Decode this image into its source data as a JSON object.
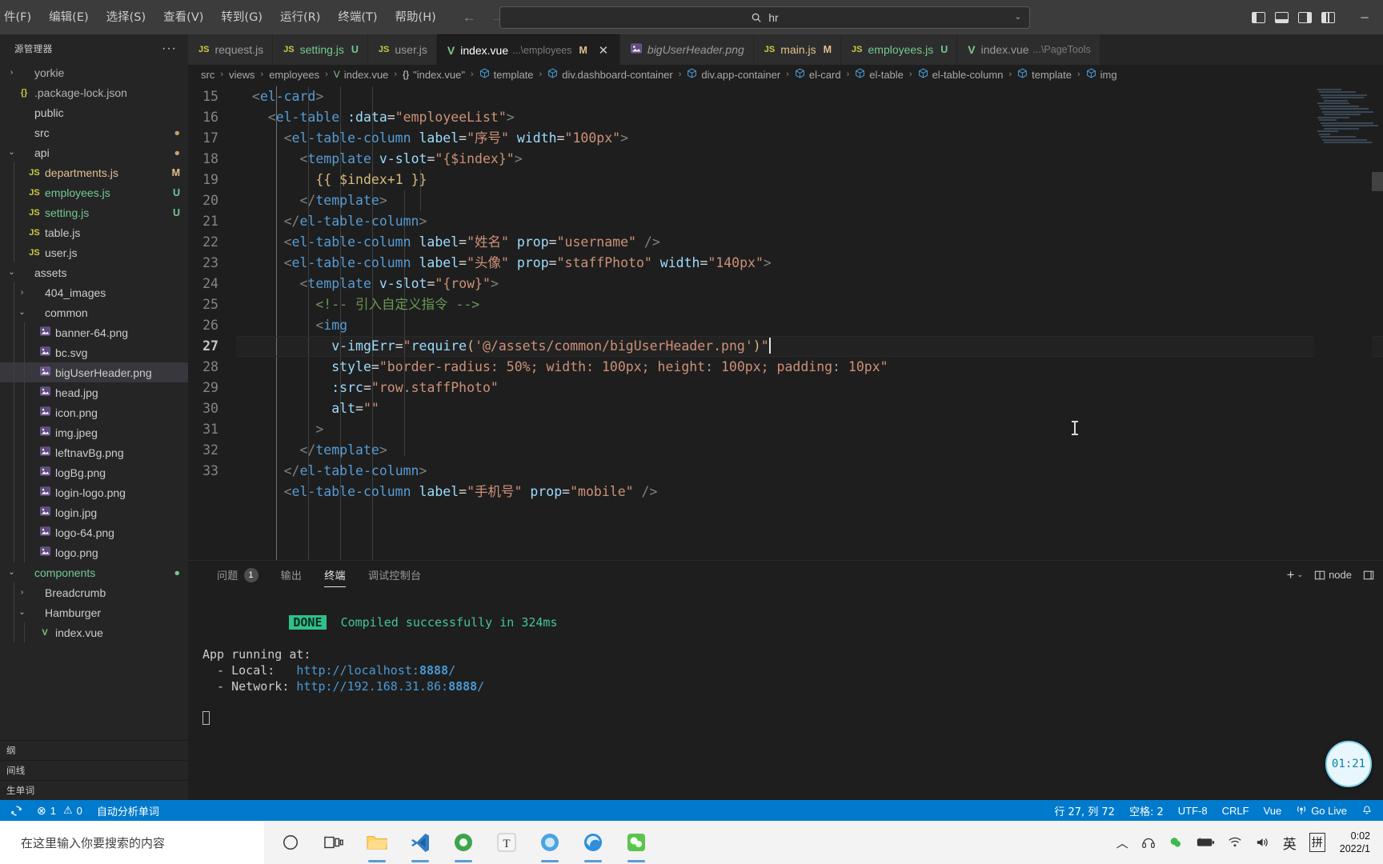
{
  "titlebar": {
    "menus": [
      "件(F)",
      "编辑(E)",
      "选择(S)",
      "查看(V)",
      "转到(G)",
      "运行(R)",
      "终端(T)",
      "帮助(H)"
    ],
    "back_icon": "←",
    "forward_icon": "→",
    "search": {
      "icon": "search-icon",
      "value": "hr",
      "chevron": "⌄"
    },
    "window_controls": {
      "minimize": "─",
      "maximize": "▢",
      "close": "✕"
    }
  },
  "sidebar": {
    "header": {
      "title": "源管理器",
      "more": "···"
    },
    "tree": [
      {
        "chev": "›",
        "icon": "",
        "icon_type": "none",
        "name": "yorkie",
        "badge": "",
        "badge_color": "",
        "indent": 0,
        "dim": true
      },
      {
        "chev": "",
        "icon": "{}",
        "icon_type": "json",
        "name": ".package-lock.json",
        "badge": "",
        "badge_color": "",
        "indent": 0,
        "dim": true
      },
      {
        "chev": "",
        "icon": "",
        "icon_type": "none",
        "name": "public",
        "badge": "",
        "badge_color": "",
        "indent": 0
      },
      {
        "chev": "",
        "icon": "",
        "icon_type": "none",
        "name": "src",
        "badge": "●",
        "badge_color": "#c5a06a",
        "indent": 0
      },
      {
        "chev": "⌄",
        "icon": "",
        "icon_type": "none",
        "name": "api",
        "badge": "●",
        "badge_color": "#c5a06a",
        "indent": 0
      },
      {
        "chev": "",
        "icon": "JS",
        "icon_type": "js",
        "name": "departments.js",
        "badge": "M",
        "badge_color": "#e2c08d",
        "indent": 1,
        "name_color": "#e2c08d"
      },
      {
        "chev": "",
        "icon": "JS",
        "icon_type": "js",
        "name": "employees.js",
        "badge": "U",
        "badge_color": "#73c991",
        "indent": 1,
        "name_color": "#73c991"
      },
      {
        "chev": "",
        "icon": "JS",
        "icon_type": "js",
        "name": "setting.js",
        "badge": "U",
        "badge_color": "#73c991",
        "indent": 1,
        "name_color": "#73c991"
      },
      {
        "chev": "",
        "icon": "JS",
        "icon_type": "js",
        "name": "table.js",
        "badge": "",
        "badge_color": "",
        "indent": 1
      },
      {
        "chev": "",
        "icon": "JS",
        "icon_type": "js",
        "name": "user.js",
        "badge": "",
        "badge_color": "",
        "indent": 1
      },
      {
        "chev": "⌄",
        "icon": "",
        "icon_type": "none",
        "name": "assets",
        "badge": "",
        "badge_color": "",
        "indent": 0
      },
      {
        "chev": "›",
        "icon": "",
        "icon_type": "none",
        "name": "404_images",
        "badge": "",
        "badge_color": "",
        "indent": 1
      },
      {
        "chev": "⌄",
        "icon": "",
        "icon_type": "none",
        "name": "common",
        "badge": "",
        "badge_color": "",
        "indent": 1
      },
      {
        "chev": "",
        "icon": "▣",
        "icon_type": "png",
        "name": "banner-64.png",
        "badge": "",
        "badge_color": "",
        "indent": 2
      },
      {
        "chev": "",
        "icon": "◧",
        "icon_type": "svg",
        "name": "bc.svg",
        "badge": "",
        "badge_color": "",
        "indent": 2
      },
      {
        "chev": "",
        "icon": "▣",
        "icon_type": "png",
        "name": "bigUserHeader.png",
        "badge": "",
        "badge_color": "",
        "indent": 2,
        "selected": true
      },
      {
        "chev": "",
        "icon": "▣",
        "icon_type": "png",
        "name": "head.jpg",
        "badge": "",
        "badge_color": "",
        "indent": 2
      },
      {
        "chev": "",
        "icon": "▣",
        "icon_type": "png",
        "name": "icon.png",
        "badge": "",
        "badge_color": "",
        "indent": 2
      },
      {
        "chev": "",
        "icon": "▣",
        "icon_type": "png",
        "name": "img.jpeg",
        "badge": "",
        "badge_color": "",
        "indent": 2
      },
      {
        "chev": "",
        "icon": "▣",
        "icon_type": "png",
        "name": "leftnavBg.png",
        "badge": "",
        "badge_color": "",
        "indent": 2
      },
      {
        "chev": "",
        "icon": "▣",
        "icon_type": "png",
        "name": "logBg.png",
        "badge": "",
        "badge_color": "",
        "indent": 2
      },
      {
        "chev": "",
        "icon": "▣",
        "icon_type": "png",
        "name": "login-logo.png",
        "badge": "",
        "badge_color": "",
        "indent": 2
      },
      {
        "chev": "",
        "icon": "▣",
        "icon_type": "png",
        "name": "login.jpg",
        "badge": "",
        "badge_color": "",
        "indent": 2
      },
      {
        "chev": "",
        "icon": "▣",
        "icon_type": "png",
        "name": "logo-64.png",
        "badge": "",
        "badge_color": "",
        "indent": 2
      },
      {
        "chev": "",
        "icon": "▣",
        "icon_type": "png",
        "name": "logo.png",
        "badge": "",
        "badge_color": "",
        "indent": 2
      },
      {
        "chev": "⌄",
        "icon": "",
        "icon_type": "none",
        "name": "components",
        "badge": "●",
        "badge_color": "#73c991",
        "indent": 0,
        "name_color": "#73c991"
      },
      {
        "chev": "›",
        "icon": "",
        "icon_type": "none",
        "name": "Breadcrumb",
        "badge": "",
        "badge_color": "",
        "indent": 1
      },
      {
        "chev": "⌄",
        "icon": "",
        "icon_type": "none",
        "name": "Hamburger",
        "badge": "",
        "badge_color": "",
        "indent": 1
      },
      {
        "chev": "",
        "icon": "V",
        "icon_type": "vue",
        "name": "index.vue",
        "badge": "",
        "badge_color": "",
        "indent": 2
      }
    ],
    "sections": [
      {
        "label": "纲",
        "chev": "›"
      },
      {
        "label": "间线",
        "chev": "›"
      },
      {
        "label": "生单词",
        "chev": "›"
      }
    ]
  },
  "tabs": [
    {
      "icon": "JS",
      "icon_type": "js",
      "name": "request.js",
      "desc": "",
      "status": "",
      "status_color": "",
      "active": false,
      "italic": false
    },
    {
      "icon": "JS",
      "icon_type": "js",
      "name": "setting.js",
      "desc": "",
      "status": "U",
      "status_color": "#73c991",
      "name_color": "#73c991",
      "active": false,
      "italic": false
    },
    {
      "icon": "JS",
      "icon_type": "js",
      "name": "user.js",
      "desc": "",
      "status": "",
      "status_color": "",
      "active": false,
      "italic": false
    },
    {
      "icon": "V",
      "icon_type": "vue",
      "name": "index.vue",
      "desc": "...\\employees",
      "status": "M",
      "status_color": "#e2c08d",
      "name_color": "#ffffff",
      "active": true,
      "italic": false,
      "close": "✕"
    },
    {
      "icon": "▣",
      "icon_type": "png",
      "name": "bigUserHeader.png",
      "desc": "",
      "status": "",
      "status_color": "",
      "active": false,
      "italic": true
    },
    {
      "icon": "JS",
      "icon_type": "js",
      "name": "main.js",
      "desc": "",
      "status": "M",
      "status_color": "#e2c08d",
      "name_color": "#e2c08d",
      "active": false,
      "italic": false
    },
    {
      "icon": "JS",
      "icon_type": "js",
      "name": "employees.js",
      "desc": "",
      "status": "U",
      "status_color": "#73c991",
      "name_color": "#73c991",
      "active": false,
      "italic": false
    },
    {
      "icon": "V",
      "icon_type": "vue",
      "name": "index.vue",
      "desc": "...\\PageTools",
      "status": "",
      "status_color": "",
      "active": false,
      "italic": false
    }
  ],
  "breadcrumb": [
    {
      "label": "src",
      "icon": ""
    },
    {
      "label": "views",
      "icon": ""
    },
    {
      "label": "employees",
      "icon": ""
    },
    {
      "label": "index.vue",
      "icon": "vue"
    },
    {
      "label": "\"index.vue\"",
      "icon": "json"
    },
    {
      "label": "template",
      "icon": "cube"
    },
    {
      "label": "div.dashboard-container",
      "icon": "cube"
    },
    {
      "label": "div.app-container",
      "icon": "cube"
    },
    {
      "label": "el-card",
      "icon": "cube"
    },
    {
      "label": "el-table",
      "icon": "cube"
    },
    {
      "label": "el-table-column",
      "icon": "cube"
    },
    {
      "label": "template",
      "icon": "cube"
    },
    {
      "label": "img",
      "icon": "cube"
    }
  ],
  "editor": {
    "line_numbers": [
      "15",
      "16",
      "17",
      "18",
      "19",
      "20",
      "21",
      "22",
      "23",
      "24",
      "25",
      "26",
      "27",
      "28",
      "29",
      "30",
      "31",
      "32",
      "33"
    ],
    "current_line": "27",
    "lines": [
      "  <el-card>",
      "    <el-table :data=\"employeeList\">",
      "      <el-table-column label=\"序号\" width=\"100px\">",
      "        <template v-slot=\"{$index}\">",
      "          {{ $index+1 }}",
      "        </template>",
      "      </el-table-column>",
      "      <el-table-column label=\"姓名\" prop=\"username\" />",
      "      <el-table-column label=\"头像\" prop=\"staffPhoto\" width=\"140px\">",
      "        <template v-slot=\"{row}\">",
      "          <!-- 引入自定义指令 -->",
      "          <img",
      "            v-imgErr=\"require('@/assets/common/bigUserHeader.png')\"",
      "            style=\"border-radius: 50%; width: 100px; height: 100px; padding: 10px\"",
      "            :src=\"row.staffPhoto\"",
      "            alt=\"\"",
      "          >",
      "        </template>",
      "      </el-table-column>",
      "      <el-table-column label=\"手机号\" prop=\"mobile\" />"
    ]
  },
  "panel": {
    "tabs": [
      {
        "label": "问题",
        "badge": "1",
        "active": false
      },
      {
        "label": "输出",
        "badge": "",
        "active": false
      },
      {
        "label": "终端",
        "badge": "",
        "active": true
      },
      {
        "label": "调试控制台",
        "badge": "",
        "active": false
      }
    ],
    "actions": {
      "add": "+",
      "add_chev": "⌄",
      "split_icon": "split-terminal-icon",
      "shell": "node",
      "panel_icon": "maximize-panel-icon",
      "kill": "🗑"
    },
    "terminal": {
      "done_label": "DONE",
      "done_text": "Compiled successfully in 324ms",
      "running_label": "App running at:",
      "local_label": "  - Local:   ",
      "local_url_base": "http://localhost:",
      "local_port": "8888",
      "local_tail": "/",
      "network_label": "  - Network: ",
      "network_url_base": "http://192.168.31.86:",
      "network_port": "8888",
      "network_tail": "/"
    },
    "bubble": "01:21"
  },
  "statusbar": {
    "left": [
      {
        "icon": "sync-icon",
        "label": ""
      },
      {
        "icon": "error-icon",
        "label": "1",
        "icon2": "warning-icon",
        "label2": "0"
      },
      {
        "icon": "",
        "label": "自动分析单词"
      }
    ],
    "sync_glyph": "⟳",
    "error_glyph": "⊗",
    "warn_glyph": "⚠",
    "error_count": "1",
    "warn_count": "0",
    "analyze_label": "自动分析单词",
    "right": [
      {
        "label": "行 27, 列 72"
      },
      {
        "label": "空格: 2"
      },
      {
        "label": "UTF-8"
      },
      {
        "label": "CRLF"
      },
      {
        "label": "Vue"
      },
      {
        "label": "Go Live",
        "icon": "broadcast-icon"
      },
      {
        "label": "",
        "icon": "bell-icon"
      }
    ]
  },
  "taskbar": {
    "search_placeholder": "在这里输入你要搜索的内容",
    "icons": [
      {
        "name": "cortana-icon",
        "glyph": "◯"
      },
      {
        "name": "task-view-icon",
        "glyph": "❏"
      },
      {
        "name": "file-explorer-icon",
        "glyph": "🗂"
      },
      {
        "name": "vscode-icon",
        "glyph": "❮❯"
      },
      {
        "name": "browser-icon",
        "glyph": "◍"
      },
      {
        "name": "typora-icon",
        "glyph": "T"
      },
      {
        "name": "chat-icon",
        "glyph": "◉"
      },
      {
        "name": "edge-icon",
        "glyph": "◉"
      },
      {
        "name": "wechat-icon",
        "glyph": "◉"
      }
    ],
    "tray": [
      {
        "name": "show-hidden-icon",
        "glyph": "︿"
      },
      {
        "name": "headphones-icon",
        "glyph": "♪"
      },
      {
        "name": "wechat-tray-icon",
        "glyph": "✆"
      },
      {
        "name": "battery-icon",
        "glyph": "▬"
      },
      {
        "name": "wifi-icon",
        "glyph": "◗"
      },
      {
        "name": "volume-icon",
        "glyph": "🔊"
      },
      {
        "name": "ime-lang-icon",
        "glyph": "英"
      },
      {
        "name": "ime-pinyin-icon",
        "glyph": "拼"
      }
    ],
    "clock": {
      "time": "0:02",
      "date": "2022/1"
    }
  }
}
